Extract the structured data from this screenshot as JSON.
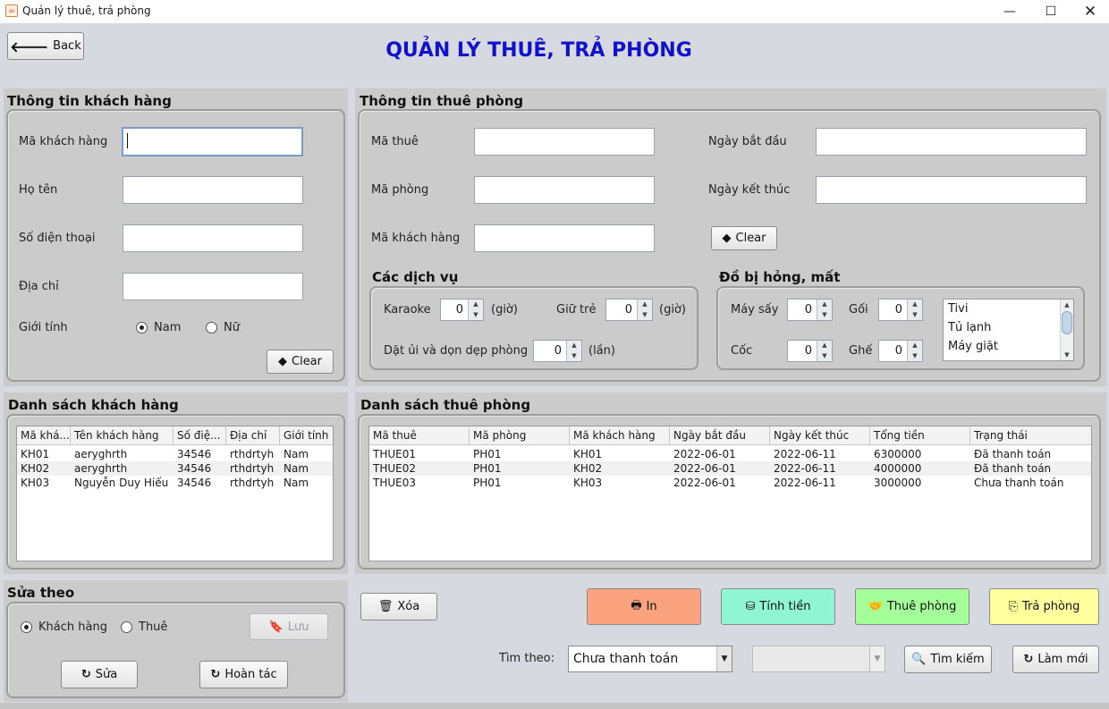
{
  "window": {
    "title": "Quản lý thuê, trả phòng",
    "controls": {
      "minimize": "—",
      "maximize": "☐",
      "close": "✕"
    }
  },
  "header": {
    "back_label": "Back",
    "title": "QUẢN LÝ THUÊ, TRẢ PHÒNG"
  },
  "customer_info": {
    "title": "Thông tin khách hàng",
    "fields": [
      {
        "label": "Mã khách hàng",
        "value": ""
      },
      {
        "label": "Họ tên",
        "value": ""
      },
      {
        "label": "Số điện thoại",
        "value": ""
      },
      {
        "label": "Địa chỉ",
        "value": ""
      }
    ],
    "gender_label": "Giới tính",
    "gender_options": [
      "Nam",
      "Nữ"
    ],
    "gender_selected": "Nam",
    "clear_label": "Clear"
  },
  "rental_info": {
    "title": "Thông tin thuê phòng",
    "left_fields": [
      {
        "label": "Mã thuê",
        "value": ""
      },
      {
        "label": "Mã phòng",
        "value": ""
      },
      {
        "label": "Mã khách hàng",
        "value": ""
      }
    ],
    "right_fields": [
      {
        "label": "Ngày bắt đầu",
        "value": ""
      },
      {
        "label": "Ngày kết thúc",
        "value": ""
      }
    ],
    "clear_label": "Clear",
    "services": {
      "title": "Các dịch vụ",
      "karaoke": {
        "label": "Karaoke",
        "value": "0",
        "unit": "(giờ)"
      },
      "childcare": {
        "label": "Giữ trẻ",
        "value": "0",
        "unit": "(giờ)"
      },
      "laundry": {
        "label": "Dặt ủi và dọn dẹp phòng",
        "value": "0",
        "unit": "(lần)"
      }
    },
    "damaged": {
      "title": "Đồ bị hỏng, mất",
      "dryer": {
        "label": "Máy sấy",
        "value": "0"
      },
      "pillow": {
        "label": "Gối",
        "value": "0"
      },
      "cup": {
        "label": "Cốc",
        "value": "0"
      },
      "chair": {
        "label": "Ghế",
        "value": "0"
      },
      "items": [
        "Tivi",
        "Tủ lạnh",
        "Máy giặt"
      ]
    }
  },
  "customer_list": {
    "title": "Danh sách khách hàng",
    "columns": [
      "Mã khá...",
      "Tên khách hàng",
      "Số điệ...",
      "Địa chỉ",
      "Giới tính"
    ],
    "rows": [
      [
        "KH01",
        "aeryghrth",
        "34546",
        "rthdrtyh",
        "Nam"
      ],
      [
        "KH02",
        "aeryghrth",
        "34546",
        "rthdrtyh",
        "Nam"
      ],
      [
        "KH03",
        "Nguyễn Duy Hiếu",
        "34546",
        "rthdrtyh",
        "Nam"
      ]
    ]
  },
  "rental_list": {
    "title": "Danh sách thuê phòng",
    "columns": [
      "Mã thuê",
      "Mã phòng",
      "Mã khách hàng",
      "Ngày bắt đầu",
      "Ngày kết thúc",
      "Tổng tiền",
      "Trạng thái"
    ],
    "rows": [
      [
        "THUE01",
        "PH01",
        "KH01",
        "2022-06-01",
        "2022-06-11",
        "6300000",
        "Đã thanh toán"
      ],
      [
        "THUE02",
        "PH01",
        "KH02",
        "2022-06-01",
        "2022-06-11",
        "4000000",
        "Đã thanh toán"
      ],
      [
        "THUE03",
        "PH01",
        "KH03",
        "2022-06-01",
        "2022-06-11",
        "3000000",
        "Chưa thanh toán"
      ]
    ]
  },
  "edit_by": {
    "title": "Sửa theo",
    "options": [
      "Khách hàng",
      "Thuê"
    ],
    "selected": "Khách hàng",
    "save_label": "Lưu",
    "edit_label": "Sửa",
    "undo_label": "Hoàn tác"
  },
  "actions": {
    "delete_label": "Xóa",
    "print_label": "In",
    "calc_label": "Tính tiền",
    "rent_label": "Thuê phòng",
    "return_label": "Trả phòng",
    "colors": {
      "print": "#fba37f",
      "calc": "#8ff5d2",
      "rent": "#a4ff9a",
      "return": "#ffff9e"
    }
  },
  "search": {
    "label": "Tìm theo:",
    "selected": "Chưa thanh toán",
    "secondary_value": "",
    "search_label": "Tìm kiếm",
    "refresh_label": "Làm mới"
  }
}
